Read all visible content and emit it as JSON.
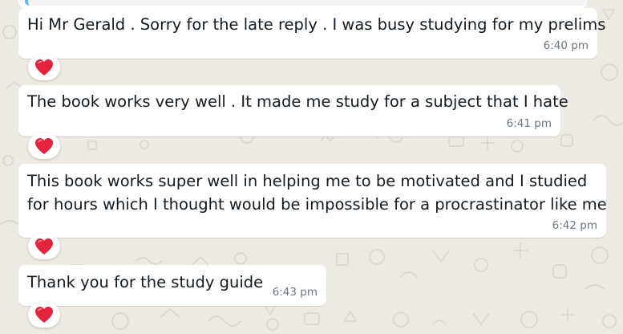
{
  "messages": [
    {
      "text_lines": [
        "Hi Mr Gerald . Sorry for the late reply . I was busy studying for my prelims"
      ],
      "time": "6:40 pm",
      "reaction": "red-heart"
    },
    {
      "text_lines": [
        "The book works very well . It made me study for a subject that I hate"
      ],
      "time": "6:41 pm",
      "reaction": "red-heart"
    },
    {
      "text_lines": [
        "This book works super well in helping me to be motivated and I studied",
        "for hours which I thought would be impossible for a procrastinator like me"
      ],
      "time": "6:42 pm",
      "reaction": "red-heart"
    },
    {
      "text_lines": [
        "Thank you for the study guide"
      ],
      "time": "6:43 pm",
      "reaction": "red-heart"
    }
  ],
  "colors": {
    "background": "#efeae2",
    "bubble": "#ffffff",
    "text": "#111b21",
    "timestamp": "#667781",
    "heart": "#e3243b",
    "quote_bar": "#53bdeb"
  }
}
